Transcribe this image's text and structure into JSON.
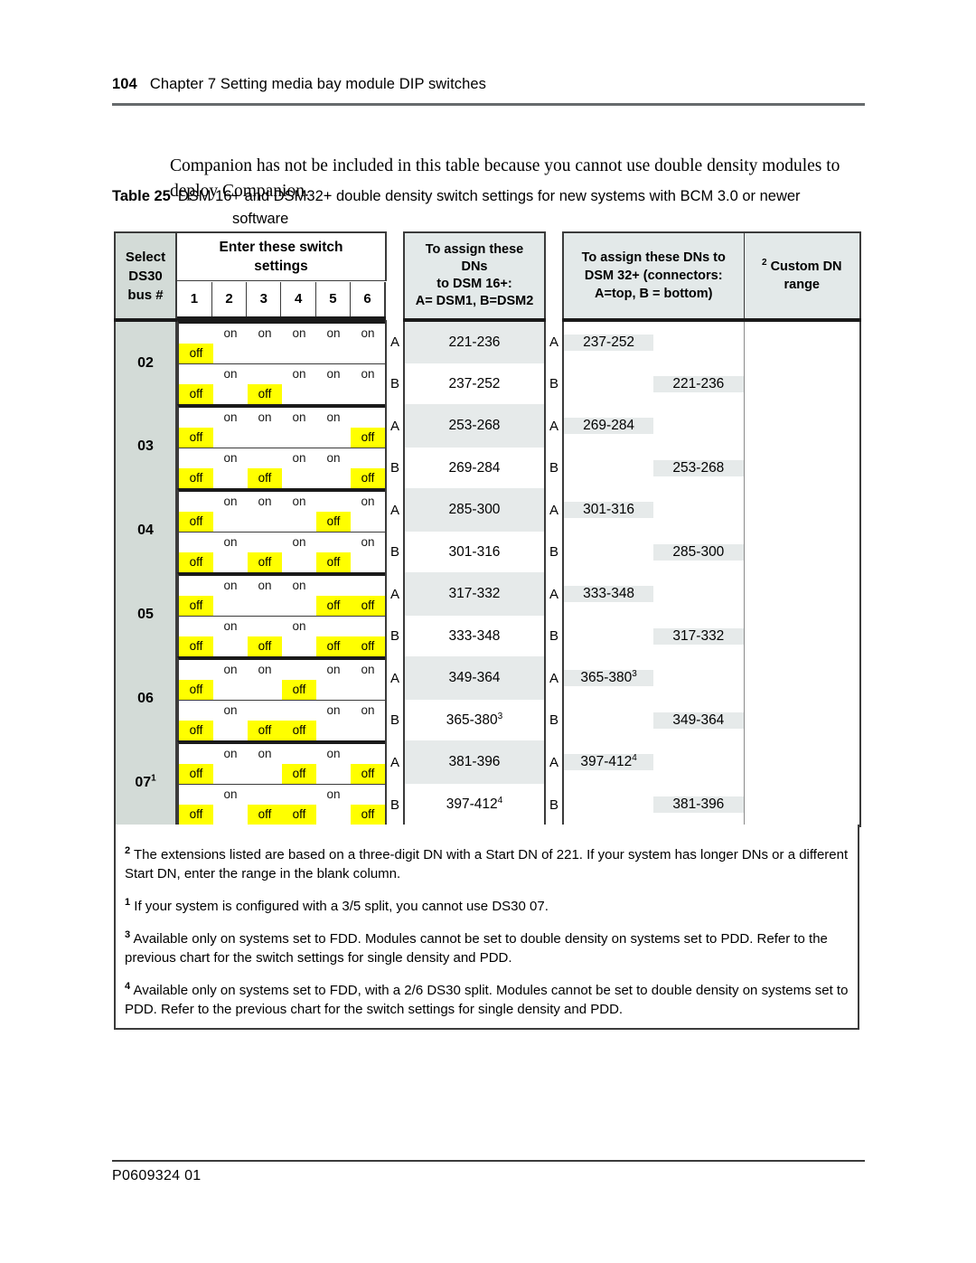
{
  "header": {
    "page_number": "104",
    "chapter": "Chapter 7  Setting media bay module DIP switches"
  },
  "intro_paragraph": "Companion has not be included in this table because you cannot use double density modules to deploy Companion.",
  "caption": {
    "label": "Table 25",
    "text": "DSM 16+ and DSM32+ double density switch settings for new systems with BCM 3.0 or newer",
    "text_line2": "software"
  },
  "table": {
    "headers": {
      "select_ds30": "Select DS30 bus #",
      "select_ds30_l1": "Select",
      "select_ds30_l2": "DS30",
      "select_ds30_l3": "bus #",
      "switch_settings_l1": "Enter these switch",
      "switch_settings_l2": "settings",
      "switch_numbers": [
        "1",
        "2",
        "3",
        "4",
        "5",
        "6"
      ],
      "dn16_l1": "To assign these",
      "dn16_l2": "DNs",
      "dn16_l3": "to DSM 16+:",
      "dn16_l4": "A= DSM1, B=DSM2",
      "dn32_l1": "To assign these DNs to",
      "dn32_l2": "DSM 32+ (connectors:",
      "dn32_l3": "A=top, B = bottom)",
      "custom_l1": "Custom DN",
      "custom_l2": "range",
      "custom_sup": "2"
    },
    "labels": {
      "on": "on",
      "off": "off",
      "a": "A",
      "b": "B"
    },
    "rows": [
      {
        "bus": "02",
        "bus_sup": "",
        "a": {
          "marker": "A",
          "switches": [
            "off",
            "on",
            "on",
            "on",
            "on",
            "on"
          ],
          "dn16": "221-236",
          "dn16_sup": "",
          "dn32": "237-252",
          "dn32_sup": ""
        },
        "b": {
          "marker": "B",
          "switches": [
            "off",
            "on",
            "off",
            "on",
            "on",
            "on"
          ],
          "dn16": "237-252",
          "dn16_sup": "",
          "dn32": "221-236",
          "dn32_sup": ""
        }
      },
      {
        "bus": "03",
        "bus_sup": "",
        "a": {
          "marker": "A",
          "switches": [
            "off",
            "on",
            "on",
            "on",
            "on",
            "off"
          ],
          "dn16": "253-268",
          "dn16_sup": "",
          "dn32": "269-284",
          "dn32_sup": ""
        },
        "b": {
          "marker": "B",
          "switches": [
            "off",
            "on",
            "off",
            "on",
            "on",
            "off"
          ],
          "dn16": "269-284",
          "dn16_sup": "",
          "dn32": "253-268",
          "dn32_sup": ""
        }
      },
      {
        "bus": "04",
        "bus_sup": "",
        "a": {
          "marker": "A",
          "switches": [
            "off",
            "on",
            "on",
            "on",
            "off",
            "on"
          ],
          "dn16": "285-300",
          "dn16_sup": "",
          "dn32": "301-316",
          "dn32_sup": ""
        },
        "b": {
          "marker": "B",
          "switches": [
            "off",
            "on",
            "off",
            "on",
            "off",
            "on"
          ],
          "dn16": "301-316",
          "dn16_sup": "",
          "dn32": "285-300",
          "dn32_sup": ""
        }
      },
      {
        "bus": "05",
        "bus_sup": "",
        "a": {
          "marker": "A",
          "switches": [
            "off",
            "on",
            "on",
            "on",
            "off",
            "off"
          ],
          "dn16": "317-332",
          "dn16_sup": "",
          "dn32": "333-348",
          "dn32_sup": ""
        },
        "b": {
          "marker": "B",
          "switches": [
            "off",
            "on",
            "off",
            "on",
            "off",
            "off"
          ],
          "dn16": "333-348",
          "dn16_sup": "",
          "dn32": "317-332",
          "dn32_sup": ""
        }
      },
      {
        "bus": "06",
        "bus_sup": "",
        "a": {
          "marker": "A",
          "switches": [
            "off",
            "on",
            "on",
            "off",
            "on",
            "on"
          ],
          "dn16": "349-364",
          "dn16_sup": "",
          "dn32": "365-380",
          "dn32_sup": "3"
        },
        "b": {
          "marker": "B",
          "switches": [
            "off",
            "on",
            "off",
            "off",
            "on",
            "on"
          ],
          "dn16": "365-380",
          "dn16_sup": "3",
          "dn32": "349-364",
          "dn32_sup": ""
        }
      },
      {
        "bus": "07",
        "bus_sup": "1",
        "a": {
          "marker": "A",
          "switches": [
            "off",
            "on",
            "on",
            "off",
            "on",
            "off"
          ],
          "dn16": "381-396",
          "dn16_sup": "",
          "dn32": "397-412",
          "dn32_sup": "4"
        },
        "b": {
          "marker": "B",
          "switches": [
            "off",
            "on",
            "off",
            "off",
            "on",
            "off"
          ],
          "dn16": "397-412",
          "dn16_sup": "4",
          "dn32": "381-396",
          "dn32_sup": ""
        }
      }
    ]
  },
  "footnotes": [
    {
      "marker": "2",
      "text": "The extensions listed are based on a three-digit DN with a Start DN of 221. If your system has longer DNs or a different Start DN, enter the range in the blank column."
    },
    {
      "marker": "1",
      "text": "If your system is configured with a 3/5 split, you cannot use DS30 07."
    },
    {
      "marker": "3",
      "text": "Available only on systems set to FDD. Modules cannot be set to double density on systems set to PDD. Refer to the previous chart for the switch settings for single density and PDD."
    },
    {
      "marker": "4",
      "text": "Available only on systems set to FDD, with a 2/6 DS30 split. Modules cannot be set to double density on systems set to PDD. Refer to the previous chart for the switch settings for single density and PDD."
    }
  ],
  "footer": {
    "document_id": "P0609324  01"
  },
  "colors": {
    "highlight": "#ffff00",
    "header_gray_green": "#d3dbd7",
    "header_blue_gray": "#e3e9e9",
    "row_shade": "#e6eaea",
    "border": "#3b3b3b"
  }
}
